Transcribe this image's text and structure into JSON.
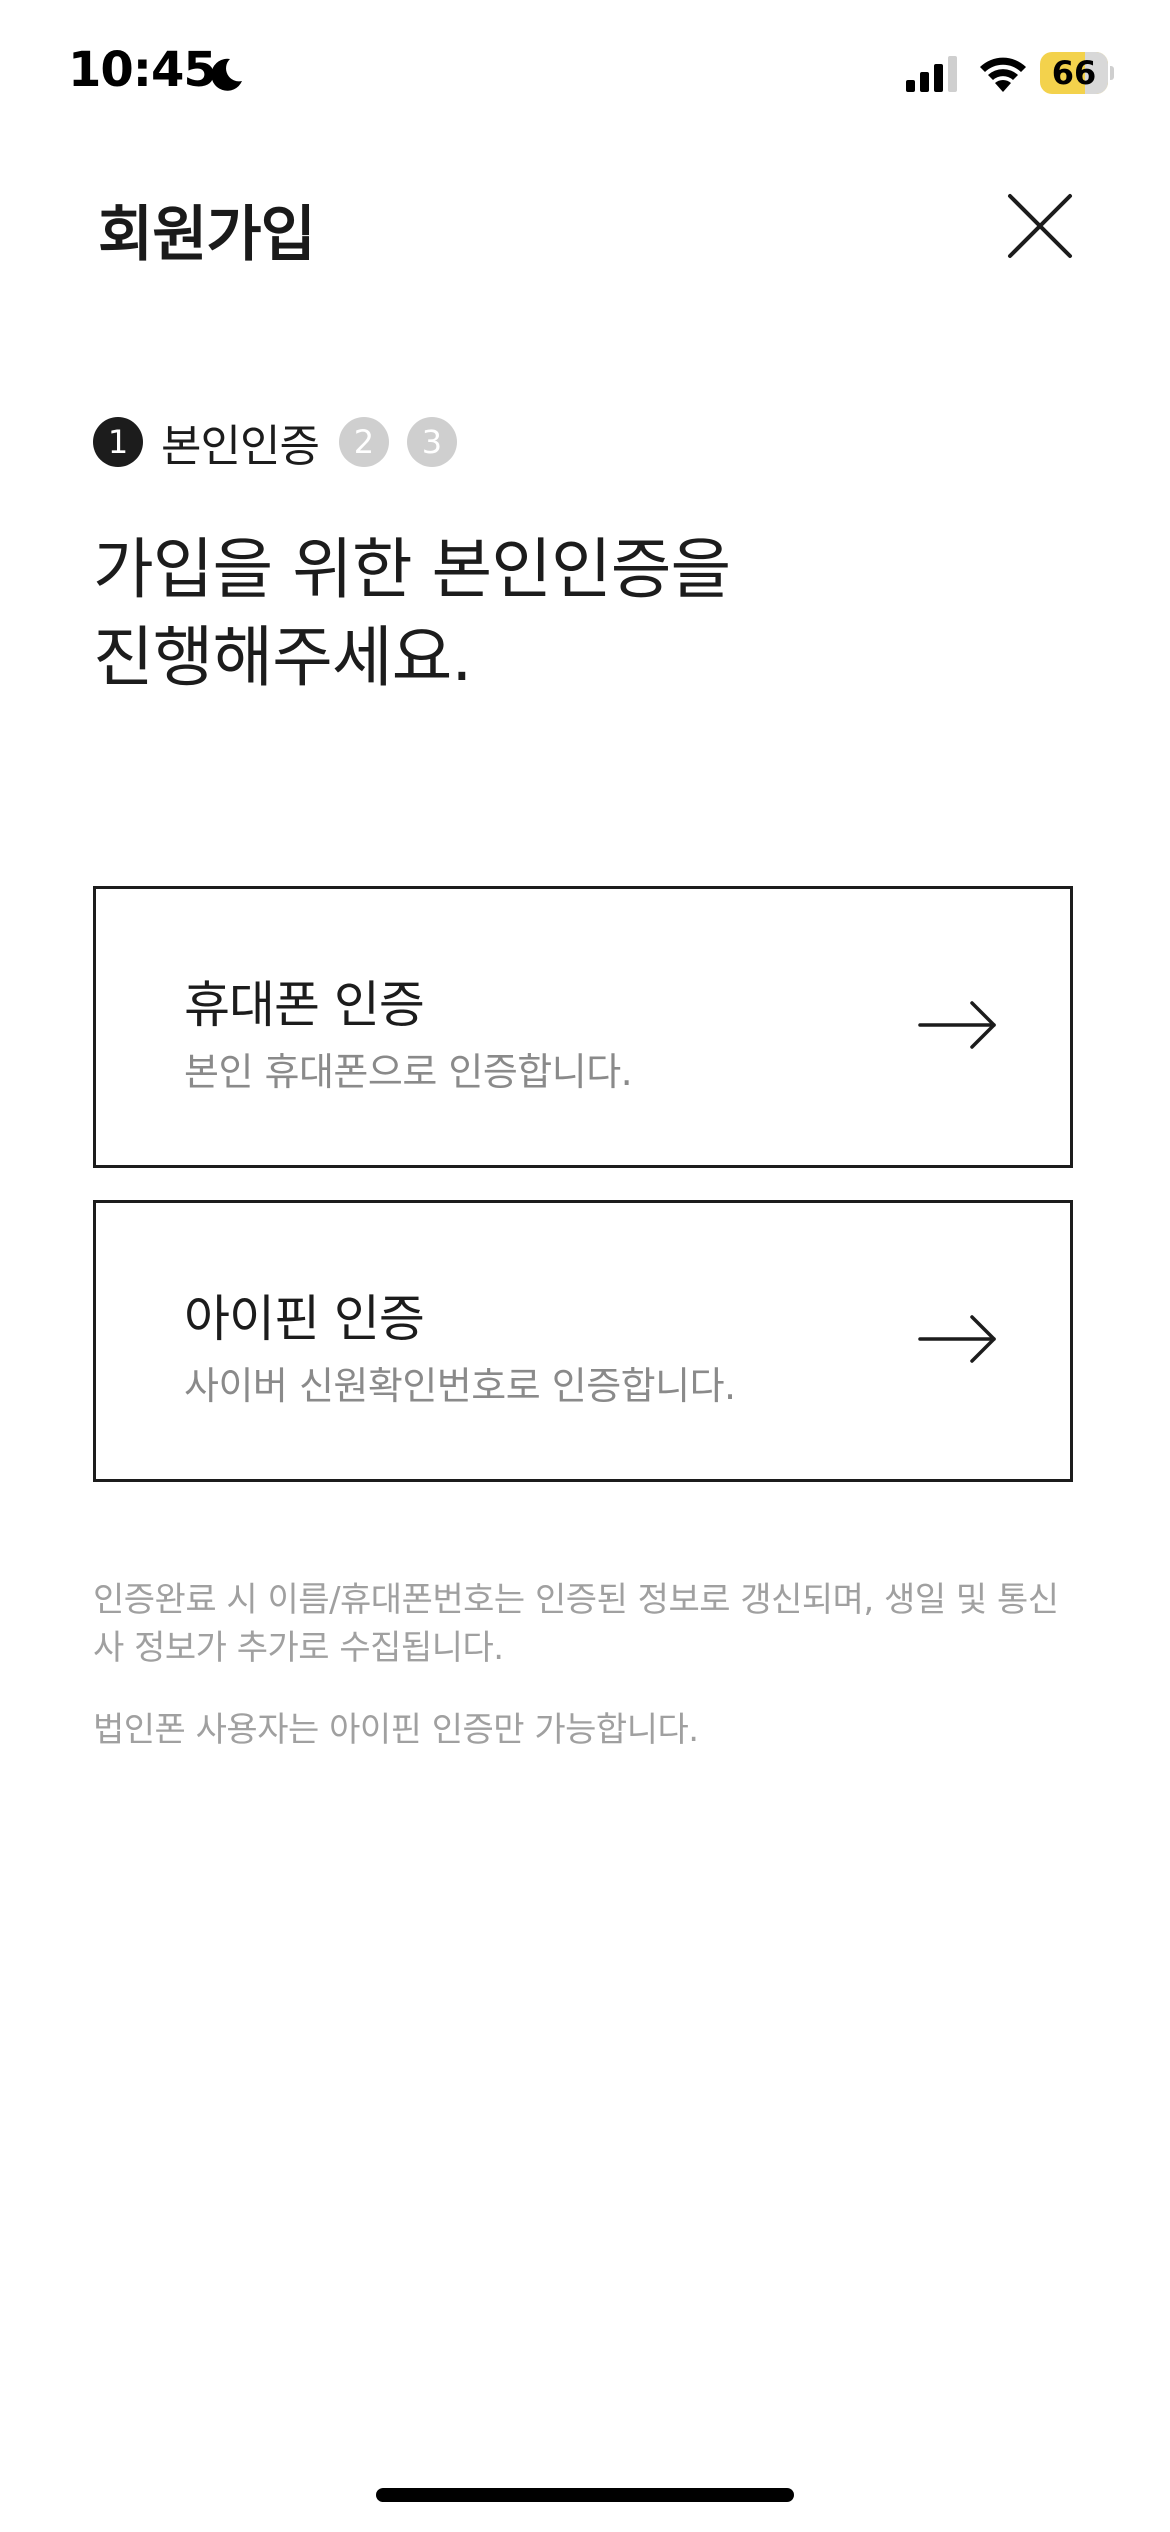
{
  "status_bar": {
    "time": "10:45",
    "battery_level": "66",
    "battery_fraction": 0.66,
    "battery_color": "#f3d24c",
    "icons": [
      "moon-icon",
      "signal-icon",
      "wifi-icon",
      "battery-icon"
    ]
  },
  "header": {
    "title": "회원가입",
    "close_icon": "close-icon"
  },
  "stepper": {
    "steps": [
      {
        "number": "1",
        "label": "본인인증",
        "active": true
      },
      {
        "number": "2",
        "label": "",
        "active": false
      },
      {
        "number": "3",
        "label": "",
        "active": false
      }
    ]
  },
  "headline": {
    "line1": "가입을 위한 본인인증을",
    "line2": "진행해주세요."
  },
  "options": [
    {
      "title": "휴대폰 인증",
      "description": "본인 휴대폰으로 인증합니다.",
      "icon": "arrow-right-icon"
    },
    {
      "title": "아이핀 인증",
      "description": "사이버 신원확인번호로 인증합니다.",
      "icon": "arrow-right-icon"
    }
  ],
  "notes": {
    "note1": "인증완료 시 이름/휴대폰번호는 인증된 정보로 갱신되며, 생일 및 통신사 정보가 추가로 수집됩니다.",
    "note2": "법인폰 사용자는 아이핀 인증만 가능합니다."
  },
  "colors": {
    "text_primary": "#1c1c1c",
    "text_secondary": "#8a8a8a",
    "text_note": "#a0a0a0",
    "step_inactive": "#cfcfcf"
  }
}
